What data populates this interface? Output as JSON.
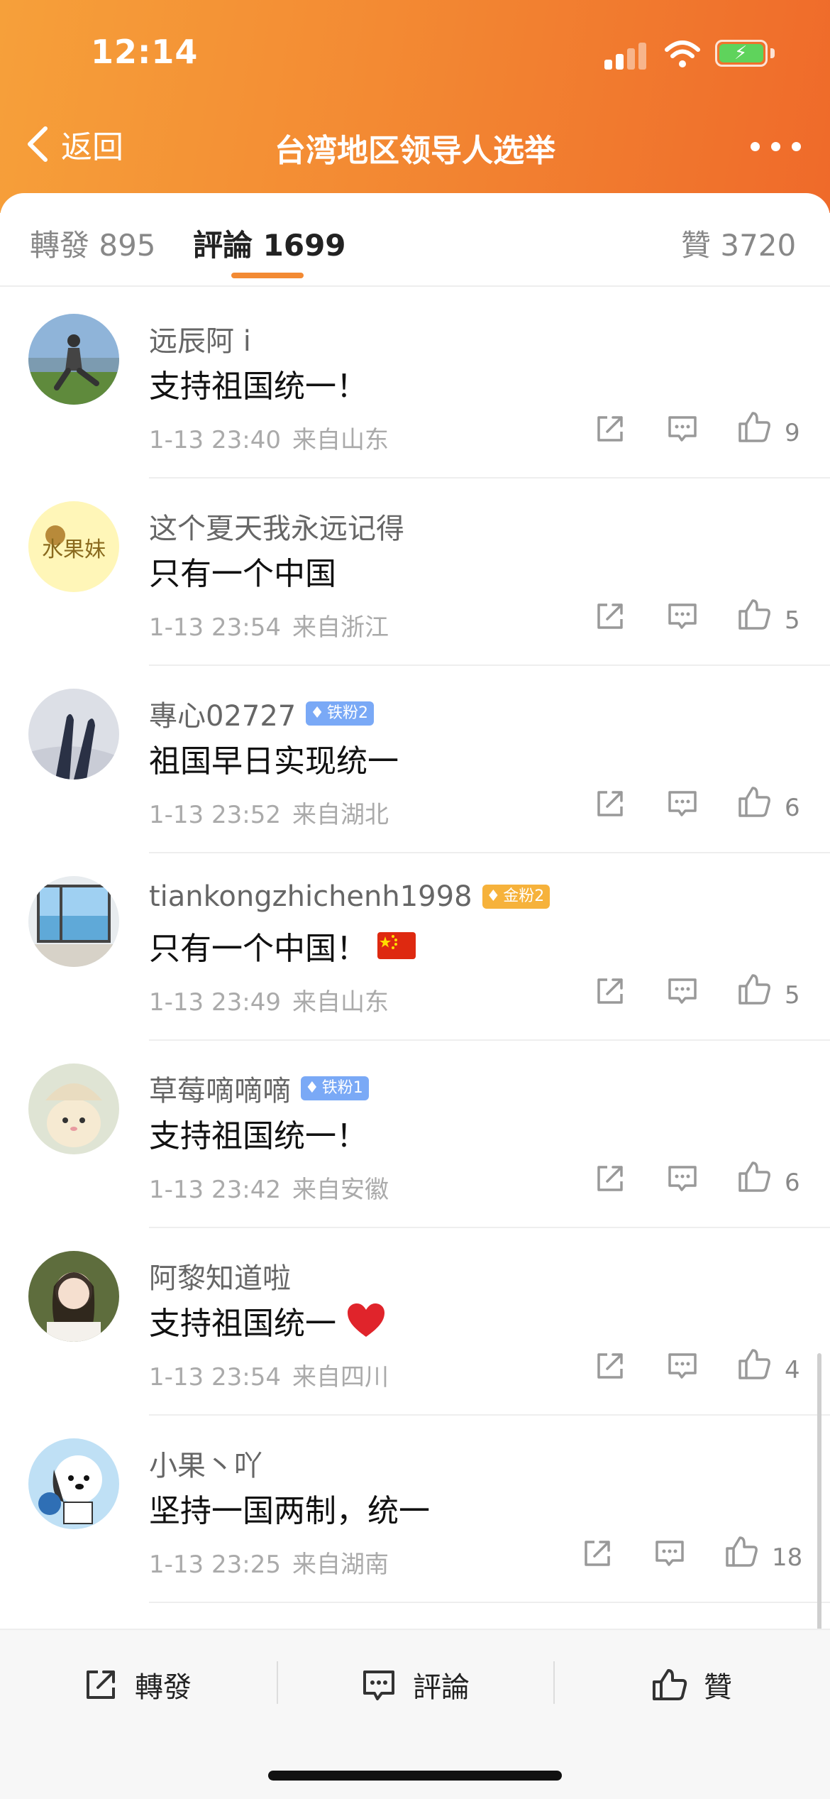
{
  "status_bar": {
    "time": "12:14"
  },
  "nav": {
    "back_label": "返回",
    "title": "台湾地区领导人选举"
  },
  "tabs": {
    "repost": "轉發 895",
    "comments": "評論 1699",
    "likes": "贊 3720"
  },
  "comments": [
    {
      "user": "远辰阿 i",
      "badge": "",
      "text": "支持祖国统一！",
      "emoji": "",
      "time": "1-13 23:40",
      "location": "来自山东",
      "likes": "9",
      "avatar": "person-on-grass"
    },
    {
      "user": "这个夏天我永远记得",
      "badge": "",
      "text": "只有一个中国",
      "emoji": "",
      "time": "1-13 23:54",
      "location": "来自浙江",
      "likes": "5",
      "avatar": "text-avatar",
      "avatar_text": "水果妹"
    },
    {
      "user": "專心02727",
      "badge": "铁粉2",
      "badge_color": "blue",
      "text": "祖国早日实现统一",
      "emoji": "",
      "time": "1-13 23:52",
      "location": "来自湖北",
      "likes": "6",
      "avatar": "shadow-on-snow"
    },
    {
      "user": "tiankongzhichenh1998",
      "badge": "金粉2",
      "badge_color": "gold",
      "text": "只有一个中国！",
      "emoji": "china-flag",
      "time": "1-13 23:49",
      "location": "来自山东",
      "likes": "5",
      "avatar": "window-room"
    },
    {
      "user": "草莓嘀嘀嘀",
      "badge": "铁粉1",
      "badge_color": "blue",
      "text": "支持祖国统一！",
      "emoji": "",
      "time": "1-13 23:42",
      "location": "来自安徽",
      "likes": "6",
      "avatar": "bunny-with-hat"
    },
    {
      "user": "阿黎知道啦",
      "badge": "",
      "text": "支持祖国统一",
      "emoji": "red-heart",
      "time": "1-13 23:54",
      "location": "来自四川",
      "likes": "4",
      "avatar": "girl-portrait"
    },
    {
      "user": "小果丶吖",
      "badge": "",
      "text": "坚持一国两制，统一",
      "emoji": "",
      "time": "1-13 23:25",
      "location": "来自湖南",
      "likes": "18",
      "avatar": "cartoon-dog"
    }
  ],
  "bottom_bar": {
    "repost": "轉發",
    "comment": "評論",
    "like": "贊"
  },
  "colors": {
    "header_start": "#f6a03a",
    "header_end": "#ef6a2a",
    "accent": "#f38a33",
    "badge_blue": "#7aa9f6",
    "badge_gold": "#f6b23b"
  },
  "icons": [
    "share-icon",
    "comment-icon",
    "like-icon",
    "back-chevron-icon",
    "more-icon"
  ]
}
